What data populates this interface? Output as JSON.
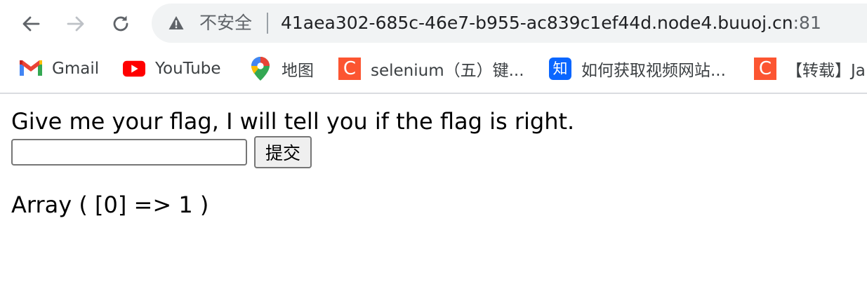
{
  "browser": {
    "security_label": "不安全",
    "url_main": "41aea302-685c-46e7-b955-ac839c1ef44d.node4.buuoj.cn",
    "url_port": ":81",
    "icons": [
      "back-icon",
      "forward-icon",
      "reload-icon",
      "warning-icon"
    ],
    "colors": {
      "omnibox_bg": "#f1f3f4",
      "text": "#202124",
      "muted": "#5f6368"
    }
  },
  "bookmarks": [
    {
      "label": "Gmail",
      "icon": "gmail-icon"
    },
    {
      "label": "YouTube",
      "icon": "youtube-icon"
    },
    {
      "label": "地图",
      "icon": "maps-icon"
    },
    {
      "label": "selenium（五）键...",
      "icon": "csdn-icon"
    },
    {
      "label": "如何获取视频网站...",
      "icon": "zhihu-icon"
    },
    {
      "label": "【转载】Ja",
      "icon": "csdn-icon"
    }
  ],
  "bookmark_icon_glyphs": {
    "csdn": "C",
    "zhihu": "知"
  },
  "page": {
    "prompt": "Give me your flag, I will tell you if the flag is right.",
    "input_value": "",
    "submit_label": "提交",
    "result": "Array ( [0] => 1 )"
  }
}
